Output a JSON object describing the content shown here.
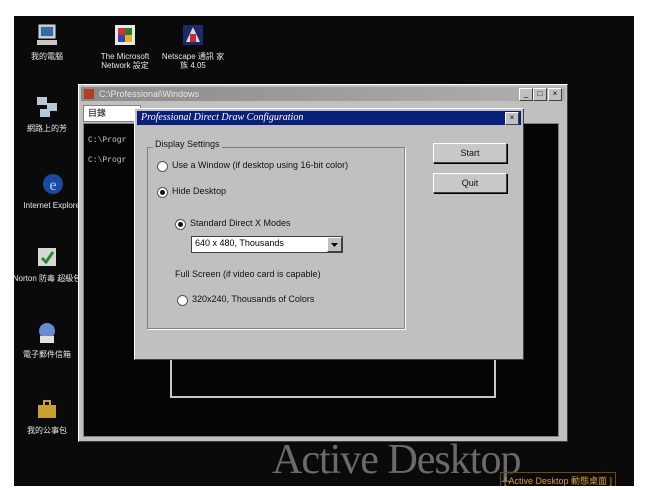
{
  "desktop": {
    "icons": [
      {
        "label": "我的電腦"
      },
      {
        "label": "The Microsoft Network 設定"
      },
      {
        "label": "Netscape 通訊 家族 4.05"
      },
      {
        "label": "網路上的芳"
      },
      {
        "label": "Internet Explorer"
      },
      {
        "label": "Norton 防毒 超級包"
      },
      {
        "label": "電子郵件信箱"
      },
      {
        "label": "我的公事包"
      }
    ],
    "active_desktop_text": "Active Desktop",
    "active_desktop_link": "[ Active Desktop 動態桌面 ]"
  },
  "back_window": {
    "title": "C:\\Professional\\Windows",
    "tab_label": "目錄",
    "console_lines": [
      "C:\\Progr",
      "C:\\Progr"
    ],
    "min_label": "_",
    "max_label": "□",
    "close_label": "×"
  },
  "dialog": {
    "title": "Professional Direct Draw Configuration",
    "close_label": "×",
    "group_label": "Display Settings",
    "option_window": "Use a Window (if desktop using 16-bit color)",
    "option_hide": "Hide Desktop",
    "option_standard": "Standard Direct X Modes",
    "mode_select_value": "640 x 480, Thousands",
    "fullscreen_label": "Full Screen (if video card is capable)",
    "option_320": "320x240, Thousands of Colors",
    "start_label": "Start",
    "quit_label": "Quit"
  }
}
